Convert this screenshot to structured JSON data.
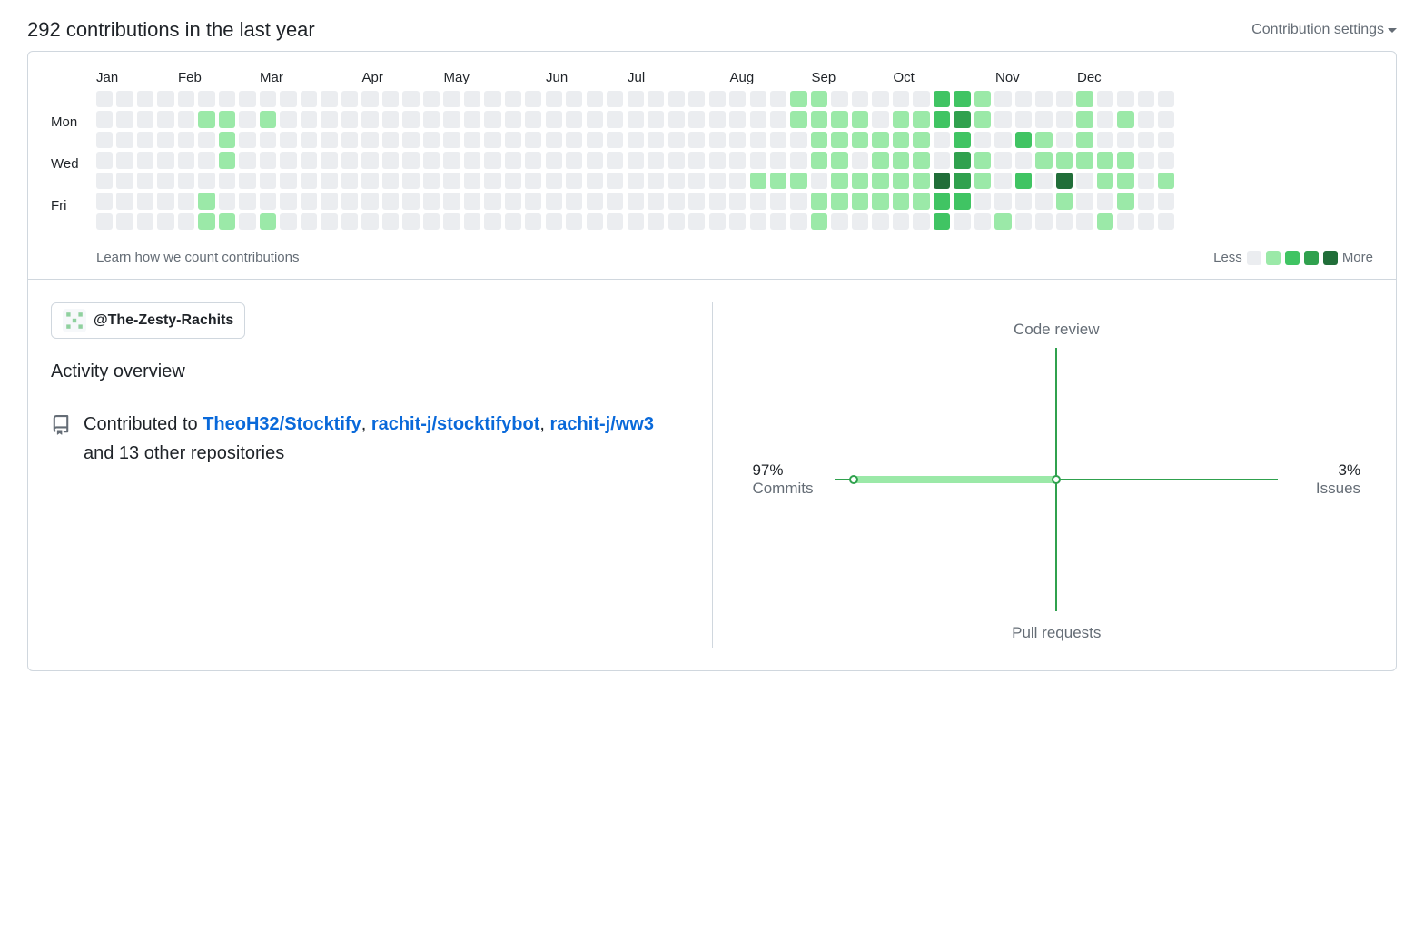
{
  "header": {
    "title": "292 contributions in the last year",
    "settings_label": "Contribution settings"
  },
  "calendar": {
    "months": [
      {
        "label": "Jan",
        "span": 4
      },
      {
        "label": "Feb",
        "span": 4
      },
      {
        "label": "Mar",
        "span": 5
      },
      {
        "label": "Apr",
        "span": 4
      },
      {
        "label": "May",
        "span": 5
      },
      {
        "label": "Jun",
        "span": 4
      },
      {
        "label": "Jul",
        "span": 5
      },
      {
        "label": "Aug",
        "span": 4
      },
      {
        "label": "Sep",
        "span": 4
      },
      {
        "label": "Oct",
        "span": 5
      },
      {
        "label": "Nov",
        "span": 4
      },
      {
        "label": "Dec",
        "span": 5
      }
    ],
    "day_labels": [
      "",
      "Mon",
      "",
      "Wed",
      "",
      "Fri",
      ""
    ],
    "weeks": [
      [
        0,
        0,
        0,
        0,
        0,
        0,
        0
      ],
      [
        0,
        0,
        0,
        0,
        0,
        0,
        0
      ],
      [
        0,
        0,
        0,
        0,
        0,
        0,
        0
      ],
      [
        0,
        0,
        0,
        0,
        0,
        0,
        0
      ],
      [
        0,
        0,
        0,
        0,
        0,
        0,
        0
      ],
      [
        0,
        1,
        0,
        0,
        0,
        1,
        1
      ],
      [
        0,
        1,
        1,
        1,
        0,
        0,
        1
      ],
      [
        0,
        0,
        0,
        0,
        0,
        0,
        0
      ],
      [
        0,
        1,
        0,
        0,
        0,
        0,
        1
      ],
      [
        0,
        0,
        0,
        0,
        0,
        0,
        0
      ],
      [
        0,
        0,
        0,
        0,
        0,
        0,
        0
      ],
      [
        0,
        0,
        0,
        0,
        0,
        0,
        0
      ],
      [
        0,
        0,
        0,
        0,
        0,
        0,
        0
      ],
      [
        0,
        0,
        0,
        0,
        0,
        0,
        0
      ],
      [
        0,
        0,
        0,
        0,
        0,
        0,
        0
      ],
      [
        0,
        0,
        0,
        0,
        0,
        0,
        0
      ],
      [
        0,
        0,
        0,
        0,
        0,
        0,
        0
      ],
      [
        0,
        0,
        0,
        0,
        0,
        0,
        0
      ],
      [
        0,
        0,
        0,
        0,
        0,
        0,
        0
      ],
      [
        0,
        0,
        0,
        0,
        0,
        0,
        0
      ],
      [
        0,
        0,
        0,
        0,
        0,
        0,
        0
      ],
      [
        0,
        0,
        0,
        0,
        0,
        0,
        0
      ],
      [
        0,
        0,
        0,
        0,
        0,
        0,
        0
      ],
      [
        0,
        0,
        0,
        0,
        0,
        0,
        0
      ],
      [
        0,
        0,
        0,
        0,
        0,
        0,
        0
      ],
      [
        0,
        0,
        0,
        0,
        0,
        0,
        0
      ],
      [
        0,
        0,
        0,
        0,
        0,
        0,
        0
      ],
      [
        0,
        0,
        0,
        0,
        0,
        0,
        0
      ],
      [
        0,
        0,
        0,
        0,
        0,
        0,
        0
      ],
      [
        0,
        0,
        0,
        0,
        0,
        0,
        0
      ],
      [
        0,
        0,
        0,
        0,
        0,
        0,
        0
      ],
      [
        0,
        0,
        0,
        0,
        0,
        0,
        0
      ],
      [
        0,
        0,
        0,
        0,
        1,
        0,
        0
      ],
      [
        0,
        0,
        0,
        0,
        1,
        0,
        0
      ],
      [
        1,
        1,
        0,
        0,
        1,
        0,
        0
      ],
      [
        1,
        1,
        1,
        1,
        0,
        1,
        1
      ],
      [
        0,
        1,
        1,
        1,
        1,
        1,
        0
      ],
      [
        0,
        1,
        1,
        0,
        1,
        1,
        0
      ],
      [
        0,
        0,
        1,
        1,
        1,
        1,
        0
      ],
      [
        0,
        1,
        1,
        1,
        1,
        1,
        0
      ],
      [
        0,
        1,
        1,
        1,
        1,
        1,
        0
      ],
      [
        2,
        2,
        0,
        0,
        4,
        2,
        2
      ],
      [
        2,
        3,
        2,
        3,
        3,
        2,
        0
      ],
      [
        1,
        1,
        0,
        1,
        1,
        0,
        0
      ],
      [
        0,
        0,
        0,
        0,
        0,
        0,
        1
      ],
      [
        0,
        0,
        2,
        0,
        2,
        0,
        0
      ],
      [
        0,
        0,
        1,
        1,
        0,
        0,
        0
      ],
      [
        0,
        0,
        0,
        1,
        4,
        1,
        0
      ],
      [
        1,
        1,
        1,
        1,
        0,
        0,
        0
      ],
      [
        0,
        0,
        0,
        1,
        1,
        0,
        1
      ],
      [
        0,
        1,
        0,
        1,
        1,
        1,
        0
      ],
      [
        0,
        0,
        0,
        0,
        0,
        0,
        0
      ],
      [
        0,
        0,
        0,
        0,
        1,
        0,
        0
      ]
    ],
    "learn_link_text": "Learn how we count contributions",
    "legend": {
      "less": "Less",
      "more": "More"
    }
  },
  "overview": {
    "org_name": "@The-Zesty-Rachits",
    "title": "Activity overview",
    "intro": "Contributed to ",
    "repos": [
      "TheoH32/Stocktify",
      "rachit-j/stocktifybot",
      "rachit-j/ww3"
    ],
    "outro": " and 13 other repositories",
    "axes": {
      "top": "Code review",
      "bottom": "Pull requests",
      "left_pct": "97%",
      "left_label": "Commits",
      "right_pct": "3%",
      "right_label": "Issues"
    }
  },
  "chart_data": {
    "type": "other",
    "description": "Radial 4-axis activity breakdown",
    "axes": [
      "Commits",
      "Code review",
      "Issues",
      "Pull requests"
    ],
    "values": {
      "Commits": 97,
      "Code review": 0,
      "Issues": 3,
      "Pull requests": 0
    },
    "unit": "percent"
  }
}
